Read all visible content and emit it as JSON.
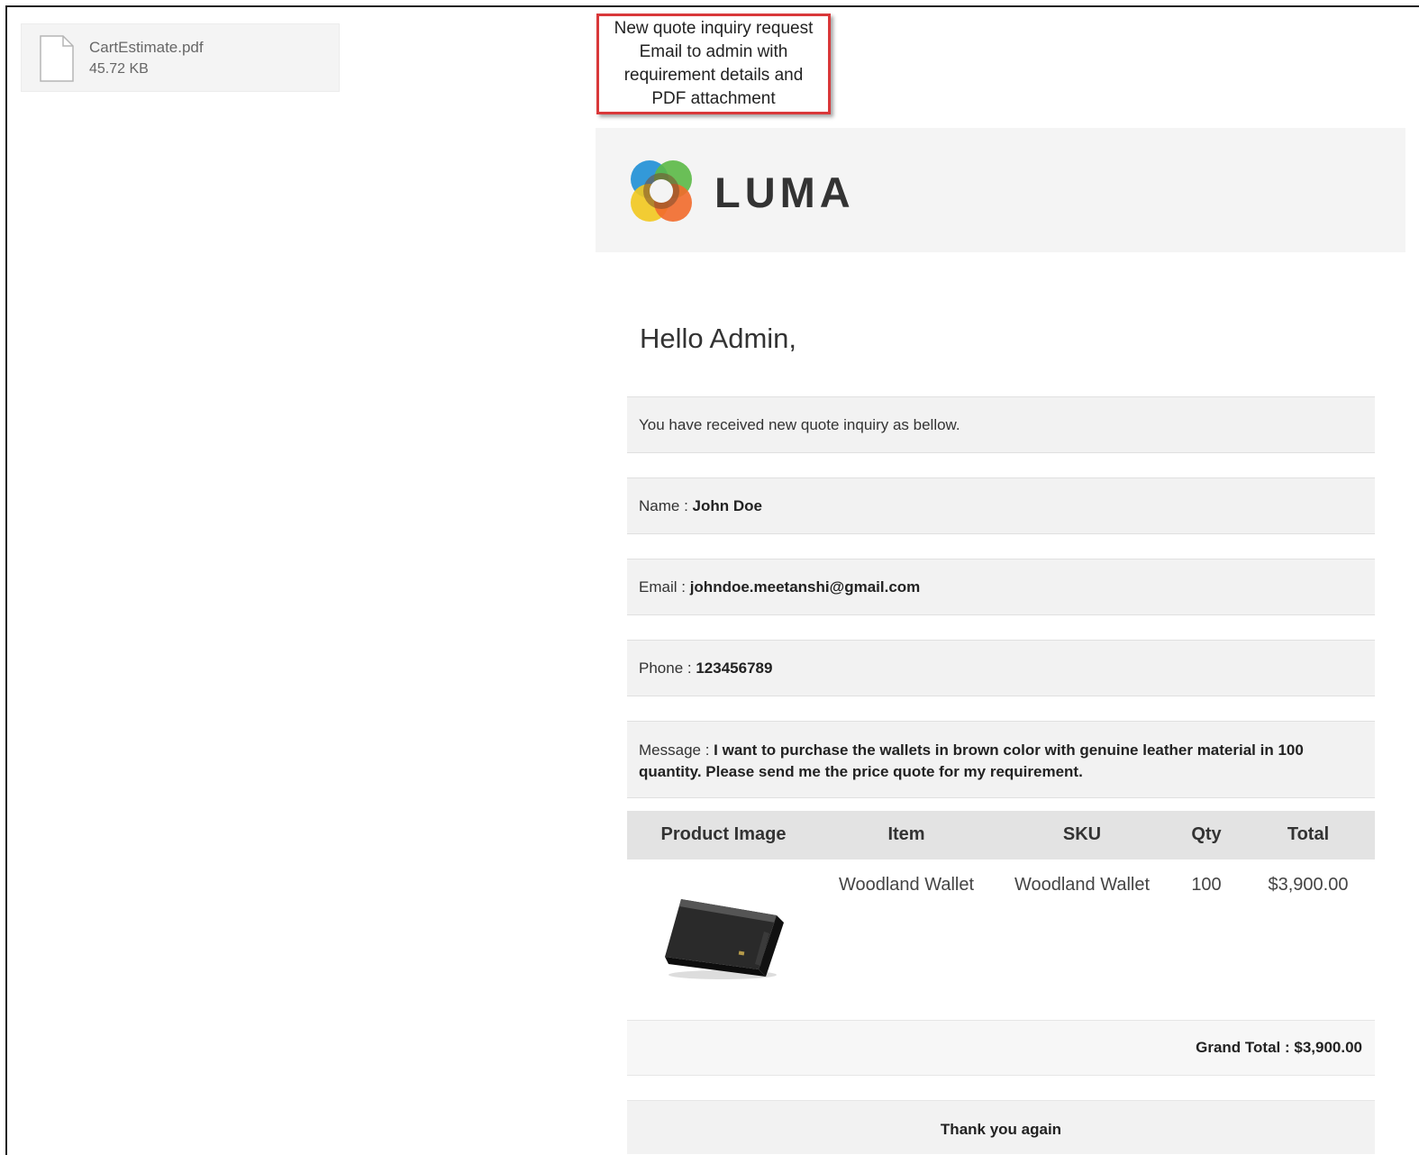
{
  "attachment": {
    "file_name": "CartEstimate.pdf",
    "file_size": "45.72 KB",
    "icon": "file-icon"
  },
  "callout": {
    "lines": [
      "New quote inquiry request",
      "Email to admin with",
      "requirement details and",
      "PDF attachment"
    ]
  },
  "header": {
    "brand": "LUMA",
    "colors": {
      "background": "#f4f4f4"
    }
  },
  "email": {
    "greeting": "Hello Admin,",
    "intro": "You have received new quote inquiry as bellow.",
    "name_label": "Name :",
    "name_value": "John Doe",
    "email_label": "Email :",
    "email_value": "johndoe.meetanshi@gmail.com",
    "phone_label": "Phone :",
    "phone_value": "123456789",
    "message_label": "Message :",
    "message_value": "I want to purchase the wallets in brown color with genuine leather material in 100 quantity. Please send me the price quote for my requirement.",
    "table": {
      "headers": [
        "Product Image",
        "Item",
        "SKU",
        "Qty",
        "Total"
      ],
      "rows": [
        {
          "item": "Woodland Wallet",
          "sku": "Woodland Wallet",
          "qty": "100",
          "total": "$3,900.00"
        }
      ]
    },
    "grand_total": "Grand Total : $3,900.00",
    "thanks": "Thank you again"
  },
  "colors": {
    "callout_border": "#d9383a",
    "row_background": "#f2f2f2",
    "table_header_background": "#e3e3e3"
  }
}
